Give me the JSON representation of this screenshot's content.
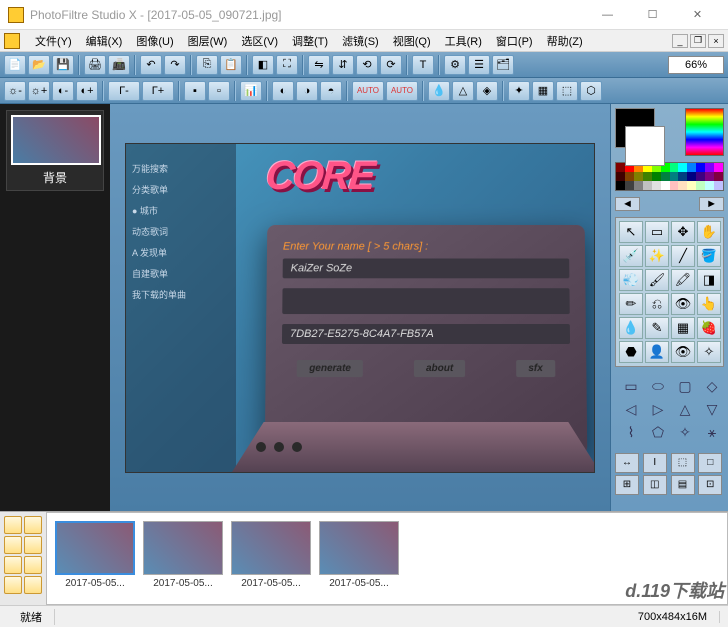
{
  "window": {
    "title": "PhotoFiltre Studio X - [2017-05-05_090721.jpg]"
  },
  "menus": [
    "文件(Y)",
    "编辑(X)",
    "图像(U)",
    "图层(W)",
    "选区(V)",
    "调整(T)",
    "滤镜(S)",
    "视图(Q)",
    "工具(R)",
    "窗口(P)",
    "帮助(Z)"
  ],
  "zoom": "66%",
  "filmstrip": {
    "label": "背景"
  },
  "keygen": {
    "logo": "CORE",
    "prompt": "Enter Your name [ > 5 chars] :",
    "name_value": "KaiZer SoZe",
    "serial_value": "7DB27-E5275-8C4A7-FB57A",
    "btn_generate": "generate",
    "btn_about": "about",
    "btn_sfx": "sfx"
  },
  "sidebar_items": [
    "万能搜索",
    "分类歌单",
    "● 城市",
    "动态歌词",
    "A 发现单",
    "自建歌单",
    "我下载的单曲"
  ],
  "thumbs": [
    "2017-05-05...",
    "2017-05-05...",
    "2017-05-05...",
    "2017-05-05..."
  ],
  "status": {
    "ready": "就绪",
    "dims": "700x484x16M"
  },
  "watermark": "d.119下载站",
  "palette_colors": [
    "#800000",
    "#ff0000",
    "#ff8000",
    "#ffff00",
    "#80ff00",
    "#00ff00",
    "#00ff80",
    "#00ffff",
    "#0080ff",
    "#0000ff",
    "#8000ff",
    "#ff00ff",
    "#400000",
    "#804000",
    "#808000",
    "#408000",
    "#008000",
    "#008040",
    "#008080",
    "#004080",
    "#000080",
    "#400080",
    "#800080",
    "#800040",
    "#000000",
    "#404040",
    "#808080",
    "#c0c0c0",
    "#e0e0e0",
    "#ffffff",
    "#ffc0c0",
    "#ffe0c0",
    "#ffffc0",
    "#c0ffc0",
    "#c0ffff",
    "#c0c0ff"
  ]
}
